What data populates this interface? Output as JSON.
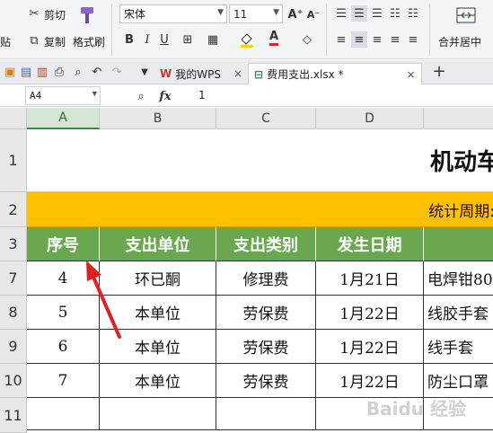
{
  "ribbon": {
    "cut_label": "剪切",
    "paste_label": "贴",
    "copy_label": "复制",
    "format_painter_label": "格式刷",
    "font_name": "宋体",
    "font_size": "11",
    "grow_font": "A⁺",
    "shrink_font": "A⁻",
    "bold": "B",
    "italic": "I",
    "underline": "U",
    "font_color_letter": "A",
    "merge_center_label": "合并居中"
  },
  "tabs": [
    {
      "label": "我的WPS",
      "active": false
    },
    {
      "label": "费用支出.xlsx *",
      "active": true
    }
  ],
  "formula_bar": {
    "name_box": "A4",
    "fx": "fx",
    "value": "1"
  },
  "columns": [
    "A",
    "B",
    "C",
    "D"
  ],
  "rows": [
    "1",
    "2",
    "3",
    "7",
    "8",
    "9",
    "10",
    "11"
  ],
  "title_text": "机动车",
  "period_text": "统计周期:",
  "table_header": [
    "序号",
    "支出单位",
    "支出类别",
    "发生日期",
    ""
  ],
  "table_rows": [
    [
      "4",
      "环已酮",
      "修理费",
      "1月21日",
      "电焊钳80"
    ],
    [
      "5",
      "本单位",
      "劳保费",
      "1月22日",
      "线胶手套"
    ],
    [
      "6",
      "本单位",
      "劳保费",
      "1月22日",
      "线手套"
    ],
    [
      "7",
      "本单位",
      "劳保费",
      "1月22日",
      "防尘口罩"
    ],
    [
      "",
      "",
      "",
      "",
      ""
    ]
  ],
  "watermark": "Baidu 经验",
  "colors": {
    "header_green": "#6aa84f",
    "period_orange": "#ffc000",
    "arrow_red": "#e02020"
  }
}
